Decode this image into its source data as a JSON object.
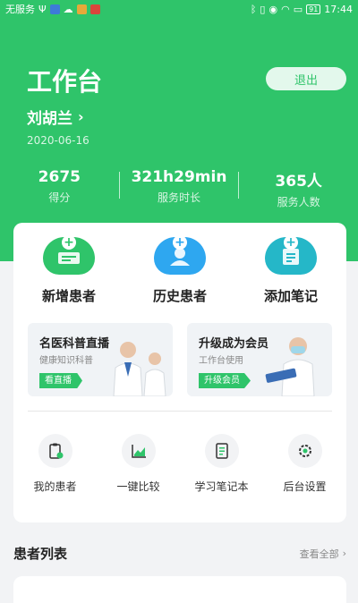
{
  "statusbar": {
    "carrier": "无服务",
    "battery": "91",
    "time": "17:44"
  },
  "header": {
    "title": "工作台",
    "logout_label": "退出",
    "user_name": "刘胡兰",
    "date": "2020-06-16"
  },
  "stats": [
    {
      "value": "2675",
      "label": "得分"
    },
    {
      "value": "321h29min",
      "label": "服务时长"
    },
    {
      "value": "365人",
      "label": "服务人数"
    }
  ],
  "quick_actions": [
    {
      "label": "新增患者",
      "icon": "add-patient-icon",
      "color": "#2fc46a"
    },
    {
      "label": "历史患者",
      "icon": "history-patient-icon",
      "color": "#2ea7f0"
    },
    {
      "label": "添加笔记",
      "icon": "add-note-icon",
      "color": "#25b7c8"
    }
  ],
  "banners": [
    {
      "title": "名医科普直播",
      "subtitle": "健康知识科普",
      "tag": "看直播"
    },
    {
      "title": "升级成为会员",
      "subtitle": "工作台使用",
      "tag": "升级会员"
    }
  ],
  "tools": [
    {
      "label": "我的患者",
      "icon": "clipboard-icon"
    },
    {
      "label": "一键比较",
      "icon": "chart-icon"
    },
    {
      "label": "学习笔记本",
      "icon": "notebook-icon"
    },
    {
      "label": "后台设置",
      "icon": "gear-icon"
    }
  ],
  "patient_list": {
    "title": "患者列表",
    "view_all": "查看全部"
  },
  "colors": {
    "accent": "#2fc46a"
  }
}
